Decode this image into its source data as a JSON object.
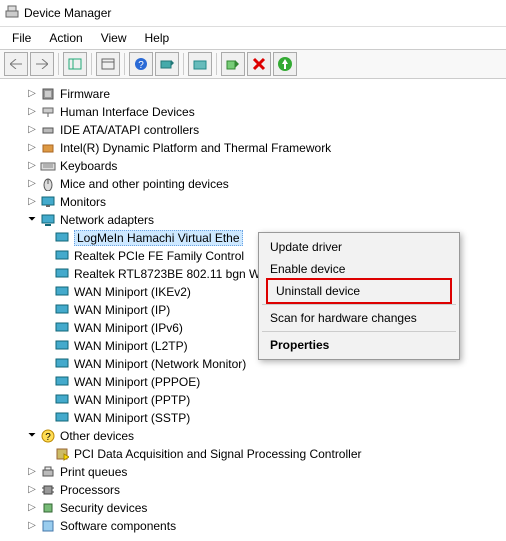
{
  "title": "Device Manager",
  "menus": {
    "file": "File",
    "action": "Action",
    "view": "View",
    "help": "Help"
  },
  "tree": {
    "firmware": "Firmware",
    "hid": "Human Interface Devices",
    "ide": "IDE ATA/ATAPI controllers",
    "intel": "Intel(R) Dynamic Platform and Thermal Framework",
    "keyboards": "Keyboards",
    "mice": "Mice and other pointing devices",
    "monitors": "Monitors",
    "network": "Network adapters",
    "net_items": [
      "LogMeIn Hamachi Virtual Ethe",
      "Realtek PCIe FE Family Control",
      "Realtek RTL8723BE 802.11 bgn W",
      "WAN Miniport (IKEv2)",
      "WAN Miniport (IP)",
      "WAN Miniport (IPv6)",
      "WAN Miniport (L2TP)",
      "WAN Miniport (Network Monitor)",
      "WAN Miniport (PPPOE)",
      "WAN Miniport (PPTP)",
      "WAN Miniport (SSTP)"
    ],
    "other": "Other devices",
    "pci": "PCI Data Acquisition and Signal Processing Controller",
    "print": "Print queues",
    "proc": "Processors",
    "security": "Security devices",
    "software": "Software components"
  },
  "context": {
    "update": "Update driver",
    "enable": "Enable device",
    "uninstall": "Uninstall device",
    "scan": "Scan for hardware changes",
    "props": "Properties"
  }
}
